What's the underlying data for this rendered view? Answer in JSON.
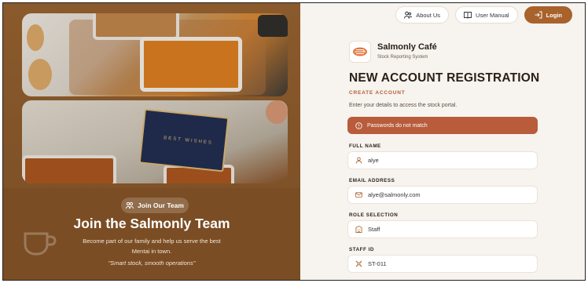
{
  "left": {
    "photo_card_text": "BEST WISHES",
    "badge_label": "Join Our Team",
    "title": "Join the Salmonly Team",
    "description": "Become part of our family and help us serve the best Mentai in town.",
    "quote": "\"Smart stock, smooth operations\""
  },
  "nav": {
    "about": "About Us",
    "manual": "User Manual",
    "login": "Login"
  },
  "brand": {
    "name": "Salmonly Café",
    "subtitle": "Stock Reporting System"
  },
  "form": {
    "title": "NEW ACCOUNT REGISTRATION",
    "subtitle": "CREATE ACCOUNT",
    "description": "Enter your details to access the stock portal.",
    "alert": "Passwords do not match",
    "fields": [
      {
        "label": "FULL NAME",
        "value": "alye",
        "icon": "user-icon"
      },
      {
        "label": "EMAIL ADDRESS",
        "value": "alye@salmonly.com",
        "icon": "mail-icon"
      },
      {
        "label": "ROLE SELECTION",
        "value": "Staff",
        "icon": "building-icon"
      },
      {
        "label": "STAFF ID",
        "value": "ST-011",
        "icon": "id-icon"
      }
    ]
  },
  "colors": {
    "left_panel": "#7a4d24",
    "accent": "#a8622c",
    "alert": "#b85c3c",
    "right_bg": "#f7f3ee"
  }
}
